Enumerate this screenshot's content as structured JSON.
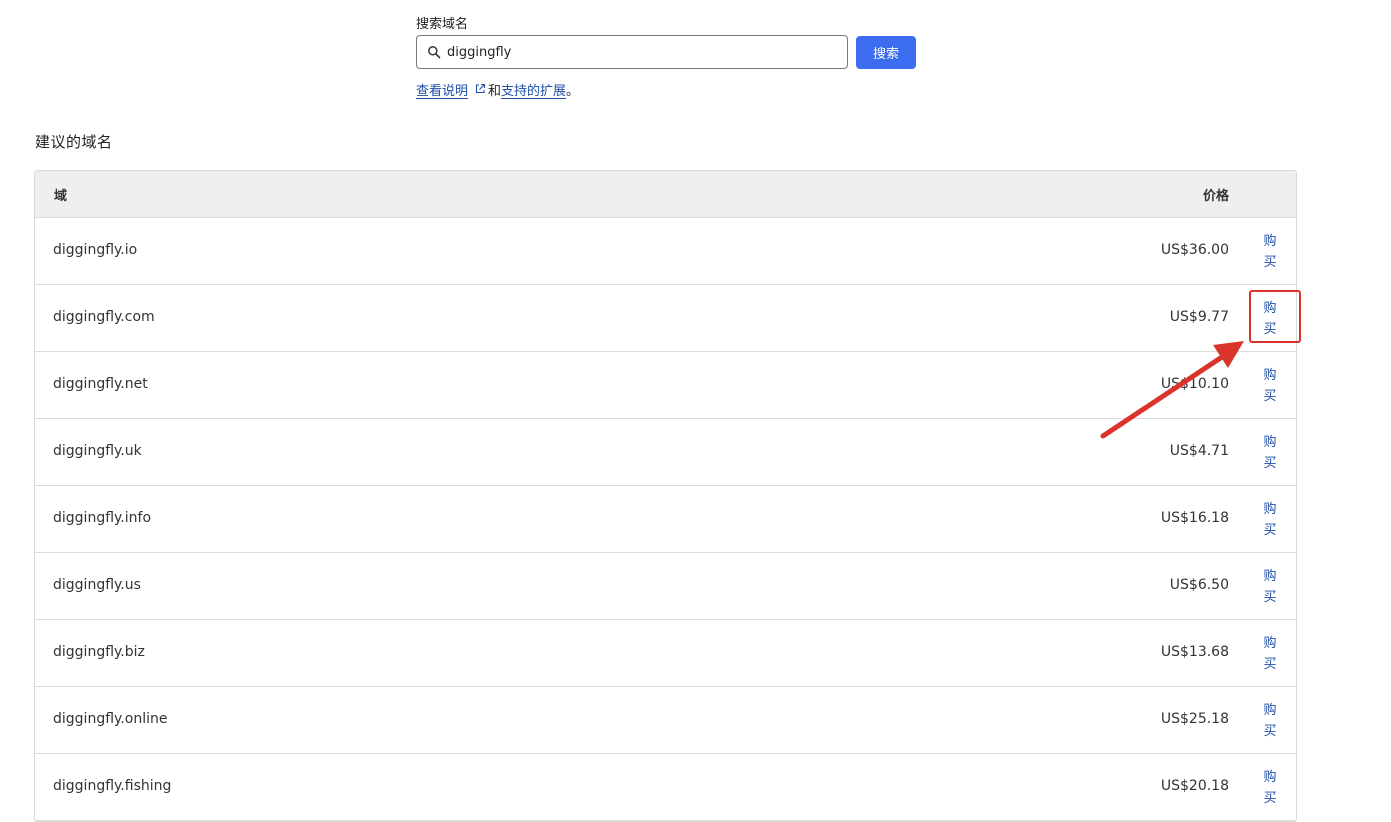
{
  "search": {
    "label": "搜索域名",
    "value": "diggingfly",
    "button_label": "搜索",
    "help_link_label": "查看说明",
    "help_joiner": "和",
    "extensions_link_label": "支持的扩展",
    "help_suffix": "。"
  },
  "suggestions": {
    "title": "建议的域名",
    "columns": {
      "domain": "域",
      "price": "价格"
    },
    "rows": [
      {
        "domain": "diggingfly.io",
        "price": "US$36.00",
        "buy": "购买"
      },
      {
        "domain": "diggingfly.com",
        "price": "US$9.77",
        "buy": "购买"
      },
      {
        "domain": "diggingfly.net",
        "price": "US$10.10",
        "buy": "购买"
      },
      {
        "domain": "diggingfly.uk",
        "price": "US$4.71",
        "buy": "购买"
      },
      {
        "domain": "diggingfly.info",
        "price": "US$16.18",
        "buy": "购买"
      },
      {
        "domain": "diggingfly.us",
        "price": "US$6.50",
        "buy": "购买"
      },
      {
        "domain": "diggingfly.biz",
        "price": "US$13.68",
        "buy": "购买"
      },
      {
        "domain": "diggingfly.online",
        "price": "US$25.18",
        "buy": "购买"
      },
      {
        "domain": "diggingfly.fishing",
        "price": "US$20.18",
        "buy": "购买"
      }
    ]
  },
  "colors": {
    "accent": "#3c6df0",
    "link": "#1f4fa8",
    "annotation": "#d9342b"
  },
  "icons": {
    "search": "search-icon",
    "external": "external-link-icon",
    "annotation_arrow": "arrow-icon"
  }
}
